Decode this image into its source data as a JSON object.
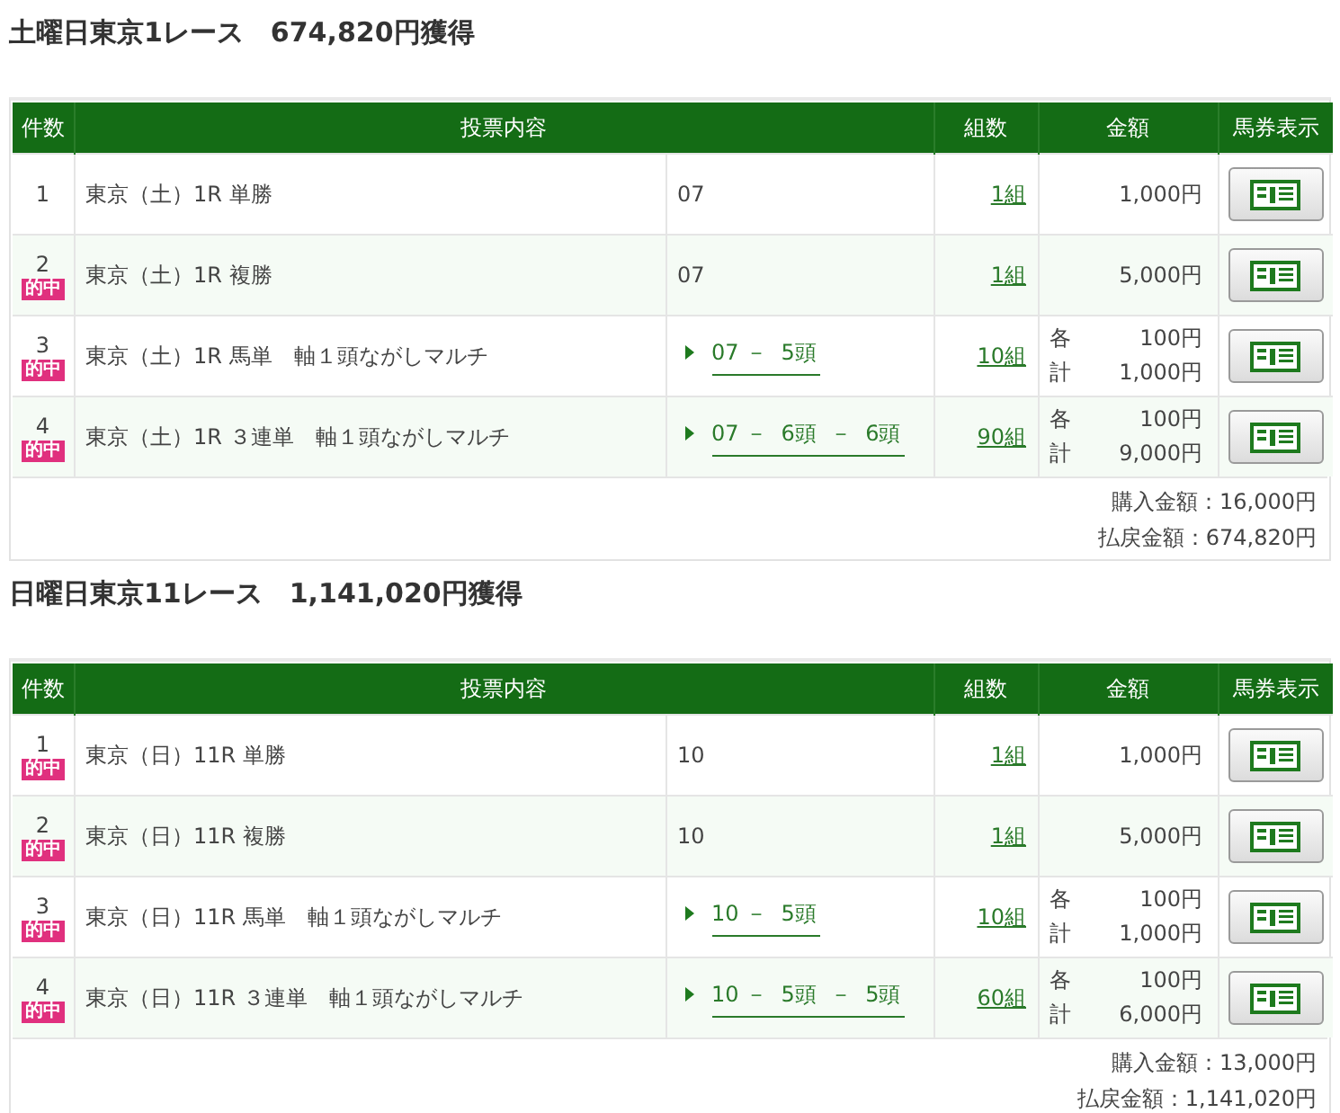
{
  "sections": [
    {
      "title": "土曜日東京1レース　674,820円獲得",
      "columns": [
        "件数",
        "投票内容",
        "組数",
        "金額",
        "馬券表示"
      ],
      "rows": [
        {
          "number": "1",
          "bet": "東京（土）1R 単勝",
          "selection": {
            "kind": "plain",
            "text": "07"
          },
          "count": "1組",
          "amount": {
            "kind": "single",
            "value": "1,000円"
          }
        },
        {
          "number": "2",
          "badge": "的中",
          "bet": "東京（土）1R 複勝",
          "selection": {
            "kind": "plain",
            "text": "07"
          },
          "count": "1組",
          "amount": {
            "kind": "single",
            "value": "5,000円"
          }
        },
        {
          "number": "3",
          "badge": "的中",
          "bet": "東京（土）1R 馬単　軸１頭ながしマルチ",
          "selection": {
            "kind": "link",
            "text": "07 －  5頭"
          },
          "count": "10組",
          "amount": {
            "kind": "multi",
            "lines": [
              {
                "label": "各",
                "value": "100円"
              },
              {
                "label": "計",
                "value": "1,000円"
              }
            ]
          }
        },
        {
          "number": "4",
          "badge": "的中",
          "bet": "東京（土）1R ３連単　軸１頭ながしマルチ",
          "selection": {
            "kind": "link",
            "text": "07 －  6頭  －  6頭"
          },
          "count": "90組",
          "amount": {
            "kind": "multi",
            "lines": [
              {
                "label": "各",
                "value": "100円"
              },
              {
                "label": "計",
                "value": "9,000円"
              }
            ]
          }
        }
      ],
      "footer": [
        "購入金額：16,000円",
        "払戻金額：674,820円"
      ]
    },
    {
      "title": "日曜日東京11レース　1,141,020円獲得",
      "columns": [
        "件数",
        "投票内容",
        "組数",
        "金額",
        "馬券表示"
      ],
      "rows": [
        {
          "number": "1",
          "badge": "的中",
          "bet": "東京（日）11R 単勝",
          "selection": {
            "kind": "plain",
            "text": "10"
          },
          "count": "1組",
          "amount": {
            "kind": "single",
            "value": "1,000円"
          }
        },
        {
          "number": "2",
          "badge": "的中",
          "bet": "東京（日）11R 複勝",
          "selection": {
            "kind": "plain",
            "text": "10"
          },
          "count": "1組",
          "amount": {
            "kind": "single",
            "value": "5,000円"
          }
        },
        {
          "number": "3",
          "badge": "的中",
          "bet": "東京（日）11R 馬単　軸１頭ながしマルチ",
          "selection": {
            "kind": "link",
            "text": "10 －  5頭"
          },
          "count": "10組",
          "amount": {
            "kind": "multi",
            "lines": [
              {
                "label": "各",
                "value": "100円"
              },
              {
                "label": "計",
                "value": "1,000円"
              }
            ]
          }
        },
        {
          "number": "4",
          "badge": "的中",
          "bet": "東京（日）11R ３連単　軸１頭ながしマルチ",
          "selection": {
            "kind": "link",
            "text": "10 －  5頭  －  5頭"
          },
          "count": "60組",
          "amount": {
            "kind": "multi",
            "lines": [
              {
                "label": "各",
                "value": "100円"
              },
              {
                "label": "計",
                "value": "6,000円"
              }
            ]
          }
        }
      ],
      "footer": [
        "購入金額：13,000円",
        "払戻金額：1,141,020円"
      ]
    }
  ]
}
